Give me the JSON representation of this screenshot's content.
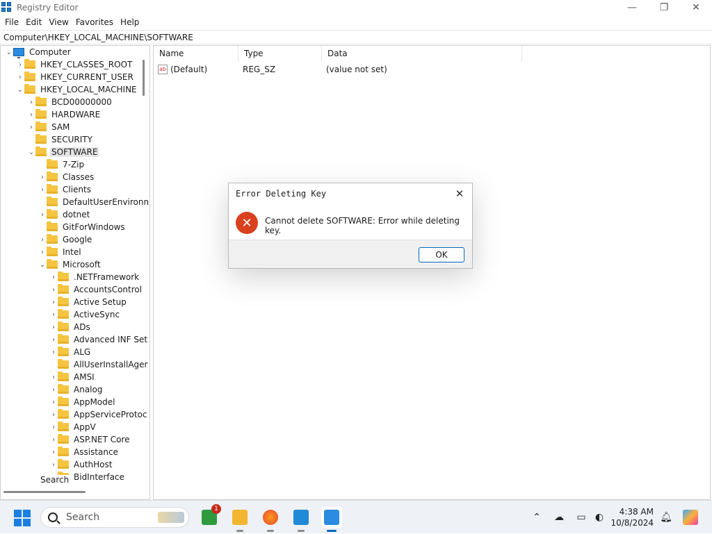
{
  "window": {
    "title": "Registry Editor",
    "minimize": "—",
    "restore": "❐",
    "close": "✕"
  },
  "menu": [
    "File",
    "Edit",
    "View",
    "Favorites",
    "Help"
  ],
  "address": "Computer\\HKEY_LOCAL_MACHINE\\SOFTWARE",
  "tree": {
    "root": "Computer",
    "hives": [
      "HKEY_CLASSES_ROOT",
      "HKEY_CURRENT_USER",
      "HKEY_LOCAL_MACHINE"
    ],
    "hklm_children": [
      "BCD00000000",
      "HARDWARE",
      "SAM",
      "SECURITY",
      "SOFTWARE"
    ],
    "software_children": [
      "7-Zip",
      "Classes",
      "Clients",
      "DefaultUserEnvironn",
      "dotnet",
      "GitForWindows",
      "Google",
      "Intel",
      "Microsoft"
    ],
    "microsoft_children": [
      ".NETFramework",
      "AccountsControl",
      "Active Setup",
      "ActiveSync",
      "ADs",
      "Advanced INF Set",
      "ALG",
      "AllUserInstallAger",
      "AMSI",
      "Analog",
      "AppModel",
      "AppServiceProtoc",
      "AppV",
      "ASP.NET Core",
      "Assistance",
      "AuthHost",
      "BidInterface"
    ],
    "search_label": "Search"
  },
  "values": {
    "columns": [
      "Name",
      "Type",
      "Data"
    ],
    "rows": [
      {
        "name": "(Default)",
        "type": "REG_SZ",
        "data": "(value not set)",
        "icon": "ab"
      }
    ]
  },
  "dialog": {
    "title": "Error Deleting Key",
    "message": "Cannot delete SOFTWARE:  Error while deleting key.",
    "ok": "OK",
    "icon": "✕",
    "close": "✕"
  },
  "taskbar": {
    "search_placeholder": "Search",
    "badge_count": "1",
    "time": "4:38 AM",
    "date": "10/8/2024",
    "colors": {
      "start": "#1a7fe0",
      "error": "#d9411e",
      "accent": "#0067c0"
    }
  }
}
